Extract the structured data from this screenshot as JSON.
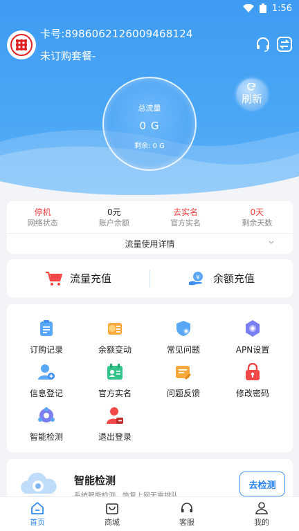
{
  "status_bar": {
    "time": "1:56"
  },
  "header": {
    "card_number": "卡号:89860621260094681​24",
    "plan": "未订购套餐-",
    "refresh_label": "刷新",
    "gauge": {
      "label": "总流量",
      "value": "0 G",
      "remaining": "剩余: 0 G"
    }
  },
  "stats": [
    {
      "value": "停机",
      "label": "网络状态",
      "tone": "red"
    },
    {
      "value": "0元",
      "label": "账户余额",
      "tone": "dark"
    },
    {
      "value": "去实名",
      "label": "官方实名",
      "tone": "red"
    },
    {
      "value": "0天",
      "label": "剩余天数",
      "tone": "red"
    }
  ],
  "detail_label": "流量使用详情",
  "recharge": {
    "data_label": "流量充值",
    "balance_label": "余额充值"
  },
  "grid": [
    {
      "label": "订购记录",
      "icon": "order-record-icon"
    },
    {
      "label": "余额变动",
      "icon": "balance-change-icon"
    },
    {
      "label": "常见问题",
      "icon": "faq-icon"
    },
    {
      "label": "APN设置",
      "icon": "apn-settings-icon"
    },
    {
      "label": "信息登记",
      "icon": "info-register-icon"
    },
    {
      "label": "官方实名",
      "icon": "real-name-icon"
    },
    {
      "label": "问题反馈",
      "icon": "feedback-icon"
    },
    {
      "label": "修改密码",
      "icon": "change-password-icon"
    },
    {
      "label": "智能检测",
      "icon": "smart-check-icon"
    },
    {
      "label": "退出登录",
      "icon": "logout-icon"
    }
  ],
  "smart_card": {
    "title": "智能检测",
    "subtitle": "系统智能检测，恢复上网无需排队",
    "button": "去检测"
  },
  "nav": [
    {
      "label": "首页",
      "active": true
    },
    {
      "label": "商城",
      "active": false
    },
    {
      "label": "客服",
      "active": false
    },
    {
      "label": "我的",
      "active": false
    }
  ],
  "colors": {
    "primary": "#3d9cf2",
    "alert": "#f24040",
    "nav_active": "#2f8cf0"
  }
}
